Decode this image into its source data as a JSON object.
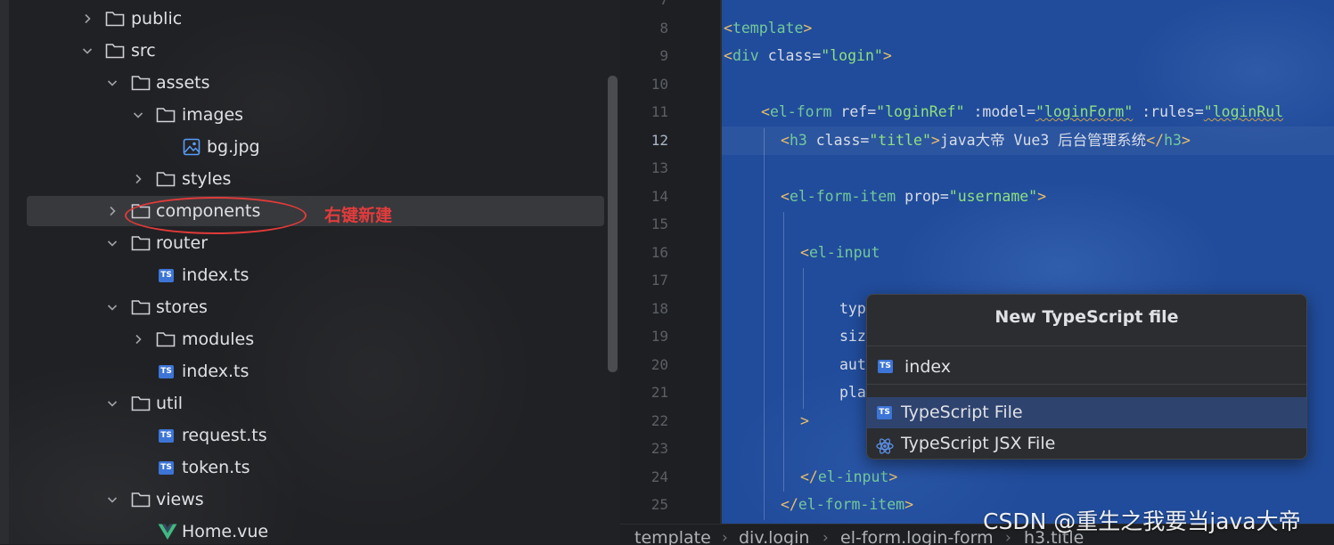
{
  "project_tree": {
    "items": [
      {
        "label": "public",
        "kind": "folder",
        "expanded": false
      },
      {
        "label": "src",
        "kind": "folder",
        "expanded": true
      },
      {
        "label": "assets",
        "kind": "folder",
        "expanded": true
      },
      {
        "label": "images",
        "kind": "folder",
        "expanded": true
      },
      {
        "label": "bg.jpg",
        "kind": "image-file"
      },
      {
        "label": "styles",
        "kind": "folder",
        "expanded": false
      },
      {
        "label": "components",
        "kind": "folder",
        "expanded": false,
        "selected": true
      },
      {
        "label": "router",
        "kind": "folder",
        "expanded": true
      },
      {
        "label": "index.ts",
        "kind": "ts-file"
      },
      {
        "label": "stores",
        "kind": "folder",
        "expanded": true
      },
      {
        "label": "modules",
        "kind": "folder",
        "expanded": false
      },
      {
        "label": "index.ts",
        "kind": "ts-file"
      },
      {
        "label": "util",
        "kind": "folder",
        "expanded": true
      },
      {
        "label": "request.ts",
        "kind": "ts-file"
      },
      {
        "label": "token.ts",
        "kind": "ts-file"
      },
      {
        "label": "views",
        "kind": "folder",
        "expanded": true
      },
      {
        "label": "Home.vue",
        "kind": "vue-file"
      }
    ],
    "annotation": "右键新建",
    "annotation_color": "#e23c3c"
  },
  "editor": {
    "line_numbers": [
      "7",
      "8",
      "9",
      "10",
      "11",
      "12",
      "13",
      "14",
      "15",
      "16",
      "17",
      "18",
      "19",
      "20",
      "21",
      "22",
      "23",
      "24",
      "25"
    ],
    "current_line": "12",
    "code": {
      "l8": {
        "tag": "template"
      },
      "l9": {
        "tag": "div",
        "attr": "class",
        "val": "\"login\""
      },
      "l11": {
        "tag": "el-form",
        "a1": "ref",
        "v1": "\"loginRef\"",
        "a2": ":model",
        "v2": "\"loginForm\"",
        "a3": ":rules",
        "v3": "\"loginRul"
      },
      "l12": {
        "tag": "h3",
        "attr": "class",
        "val": "\"title\"",
        "text": "java大帝 Vue3 后台管理系统",
        "close": "h3"
      },
      "l14": {
        "tag": "el-form-item",
        "attr": "prop",
        "val": "\"username\""
      },
      "l16": {
        "tag": "el-input"
      },
      "l18": "typ",
      "l19": "siz",
      "l20": "aut",
      "l21": "pla",
      "l22": ">",
      "l24": {
        "close": "el-input"
      },
      "l25": {
        "close": "el-form-item"
      }
    },
    "accent_bg": "#214c9b"
  },
  "popup": {
    "title": "New TypeScript file",
    "input_value": "index",
    "options": [
      {
        "label": "TypeScript File",
        "icon": "ts-file-icon",
        "selected": true
      },
      {
        "label": "TypeScript JSX File",
        "icon": "react-icon",
        "selected": false
      }
    ]
  },
  "breadcrumbs": [
    "template",
    "div.login",
    "el-form.login-form",
    "h3.title"
  ],
  "watermark": "CSDN @重生之我要当java大帝"
}
